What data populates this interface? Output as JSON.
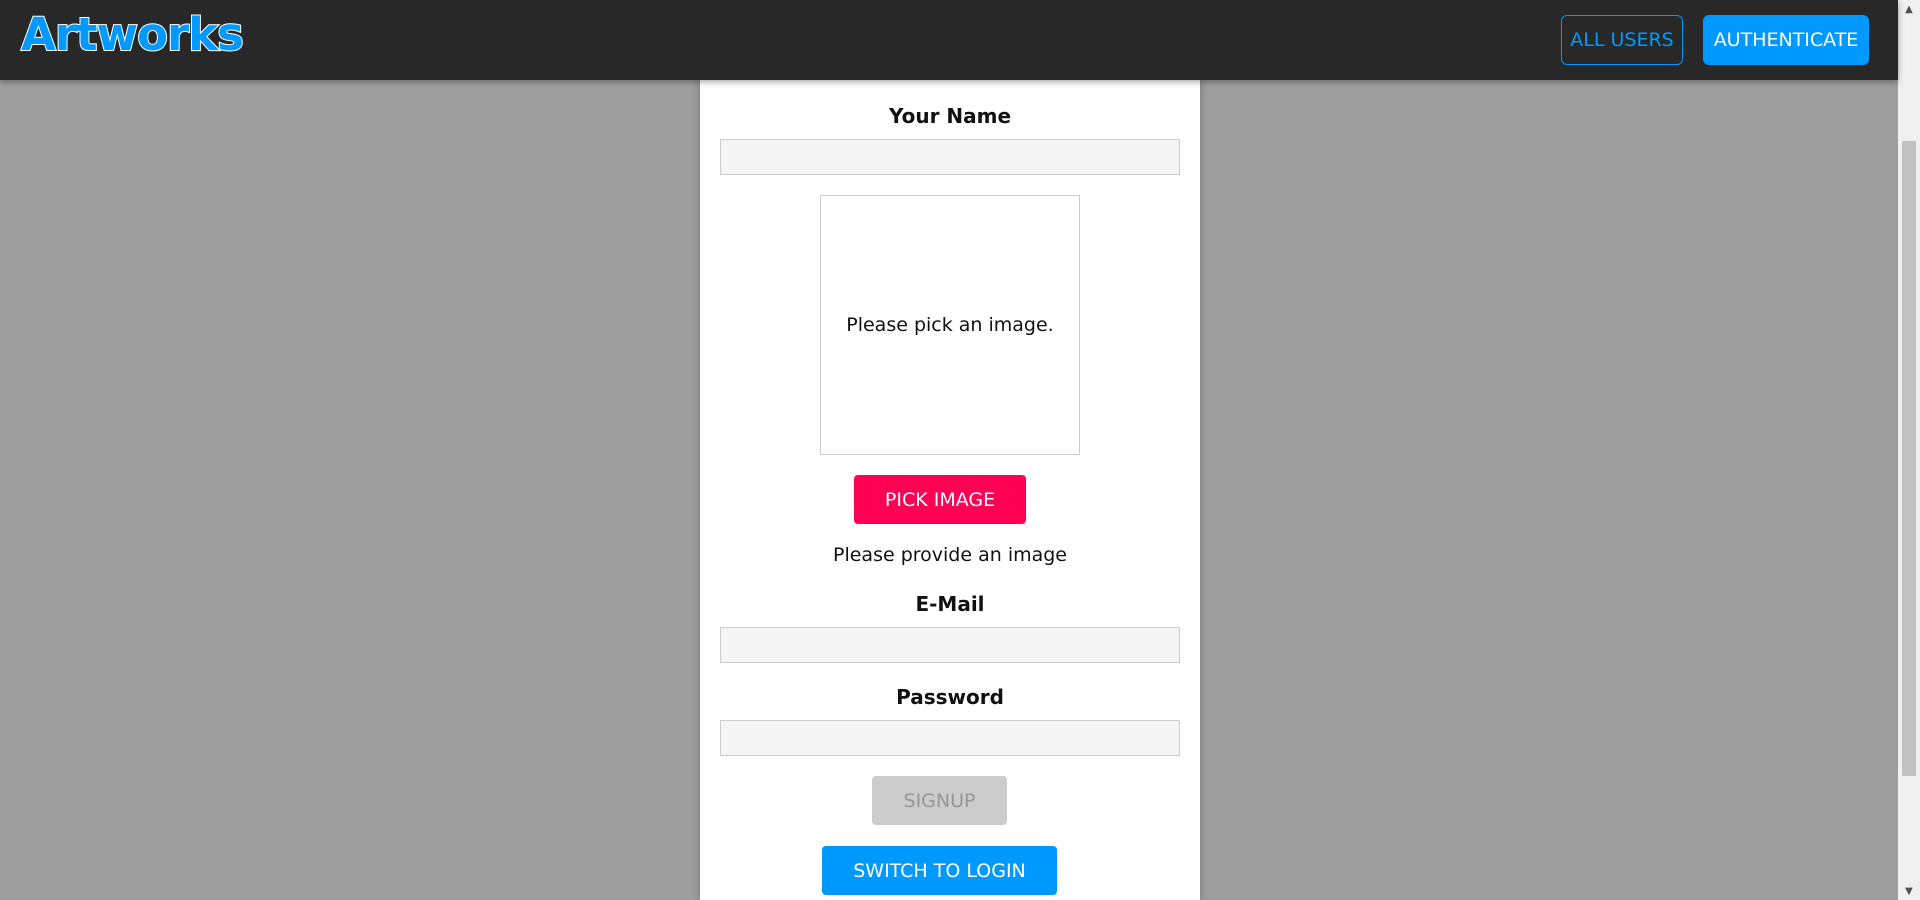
{
  "header": {
    "logo": "Artworks",
    "nav": {
      "all_users": "ALL USERS",
      "authenticate": "AUTHENTICATE"
    }
  },
  "form": {
    "name_label": "Your Name",
    "name_value": "",
    "image_placeholder": "Please pick an image.",
    "pick_image_button": "PICK IMAGE",
    "image_error": "Please provide an image",
    "email_label": "E-Mail",
    "email_value": "",
    "password_label": "Password",
    "password_value": "",
    "signup_button": "SIGNUP",
    "switch_button": "SWITCH TO LOGIN"
  },
  "colors": {
    "accent": "#0099ff",
    "pick": "#ff0055",
    "disabled": "#cccccc",
    "header_bg": "#282828",
    "backdrop": "#9e9e9e"
  }
}
